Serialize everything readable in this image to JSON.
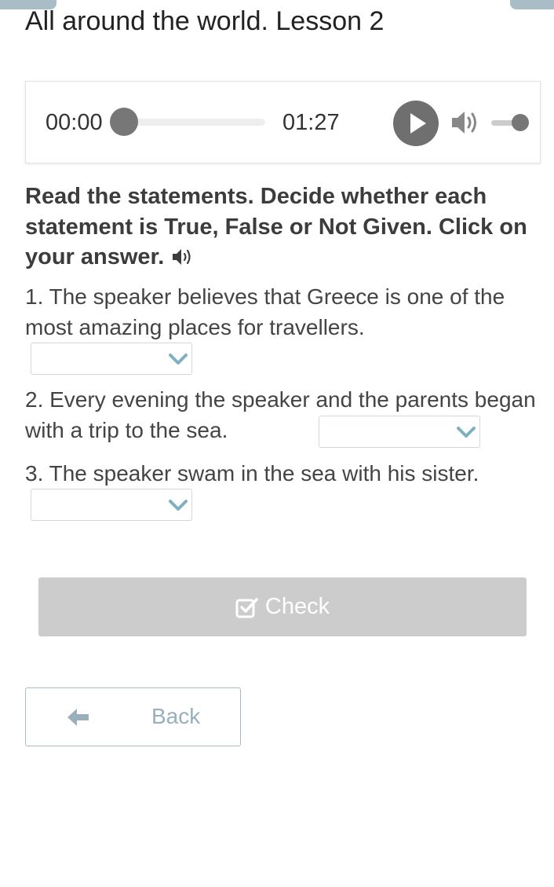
{
  "page": {
    "title": "All around the world. Lesson 2"
  },
  "audio": {
    "current_time": "00:00",
    "total_time": "01:27",
    "progress": 0,
    "volume": 1
  },
  "instructions": {
    "text": "Read the statements. Decide whether each statement is True, False or Not Given. Click on your answer."
  },
  "questions": [
    {
      "text": "1. The speaker believes that Greece is one of the most amazing places for travellers.",
      "selected": ""
    },
    {
      "text": "2. Every evening the speaker and the parents began with a trip to the sea.",
      "selected": ""
    },
    {
      "text": "3. The speaker swam in the sea with his sister.",
      "selected": ""
    }
  ],
  "buttons": {
    "check_label": "Check",
    "back_label": "Back"
  },
  "icons": {
    "play": "play-icon",
    "volume": "volume-icon",
    "speaker": "speaker-icon",
    "check": "checkbox-icon",
    "back": "arrow-left-icon",
    "dropdown": "chevron-down-icon"
  },
  "colors": {
    "accent_light": "#a9bdc7",
    "button_disabled": "#cccccc",
    "back_text": "#98b0bc",
    "chevron": "#7fb0c0"
  }
}
